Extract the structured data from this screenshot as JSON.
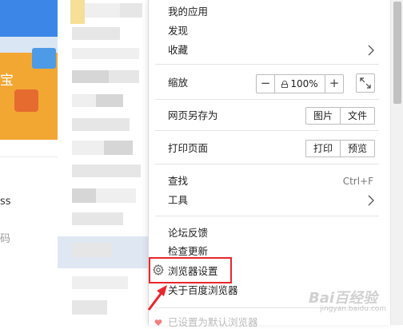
{
  "background": {
    "banner_text": "",
    "banner_big_text": "宝",
    "fragment_1": "ss",
    "fragment_2": "码"
  },
  "menu": {
    "my_apps": "我的应用",
    "discover": "发现",
    "favorites": "收藏",
    "zoom": {
      "label": "缩放",
      "minus": "−",
      "value": "100%",
      "plus": "+"
    },
    "save_page_as": {
      "label": "网页另存为",
      "image_button": "图片",
      "file_button": "文件"
    },
    "print_page": {
      "label": "打印页面",
      "print_button": "打印",
      "preview_button": "预览"
    },
    "find": {
      "label": "查找",
      "shortcut": "Ctrl+F"
    },
    "tools": "工具",
    "forum_feedback": "论坛反馈",
    "check_updates": "检查更新",
    "browser_settings": "浏览器设置",
    "about": "关于百度浏览器",
    "default_browser": "已设置为默认浏览器"
  },
  "watermark": {
    "brand": "Bai百经验",
    "sub": "jingyan.baidu.com"
  },
  "colors": {
    "highlight": "#e8262d",
    "arrow": "#e8262d"
  }
}
